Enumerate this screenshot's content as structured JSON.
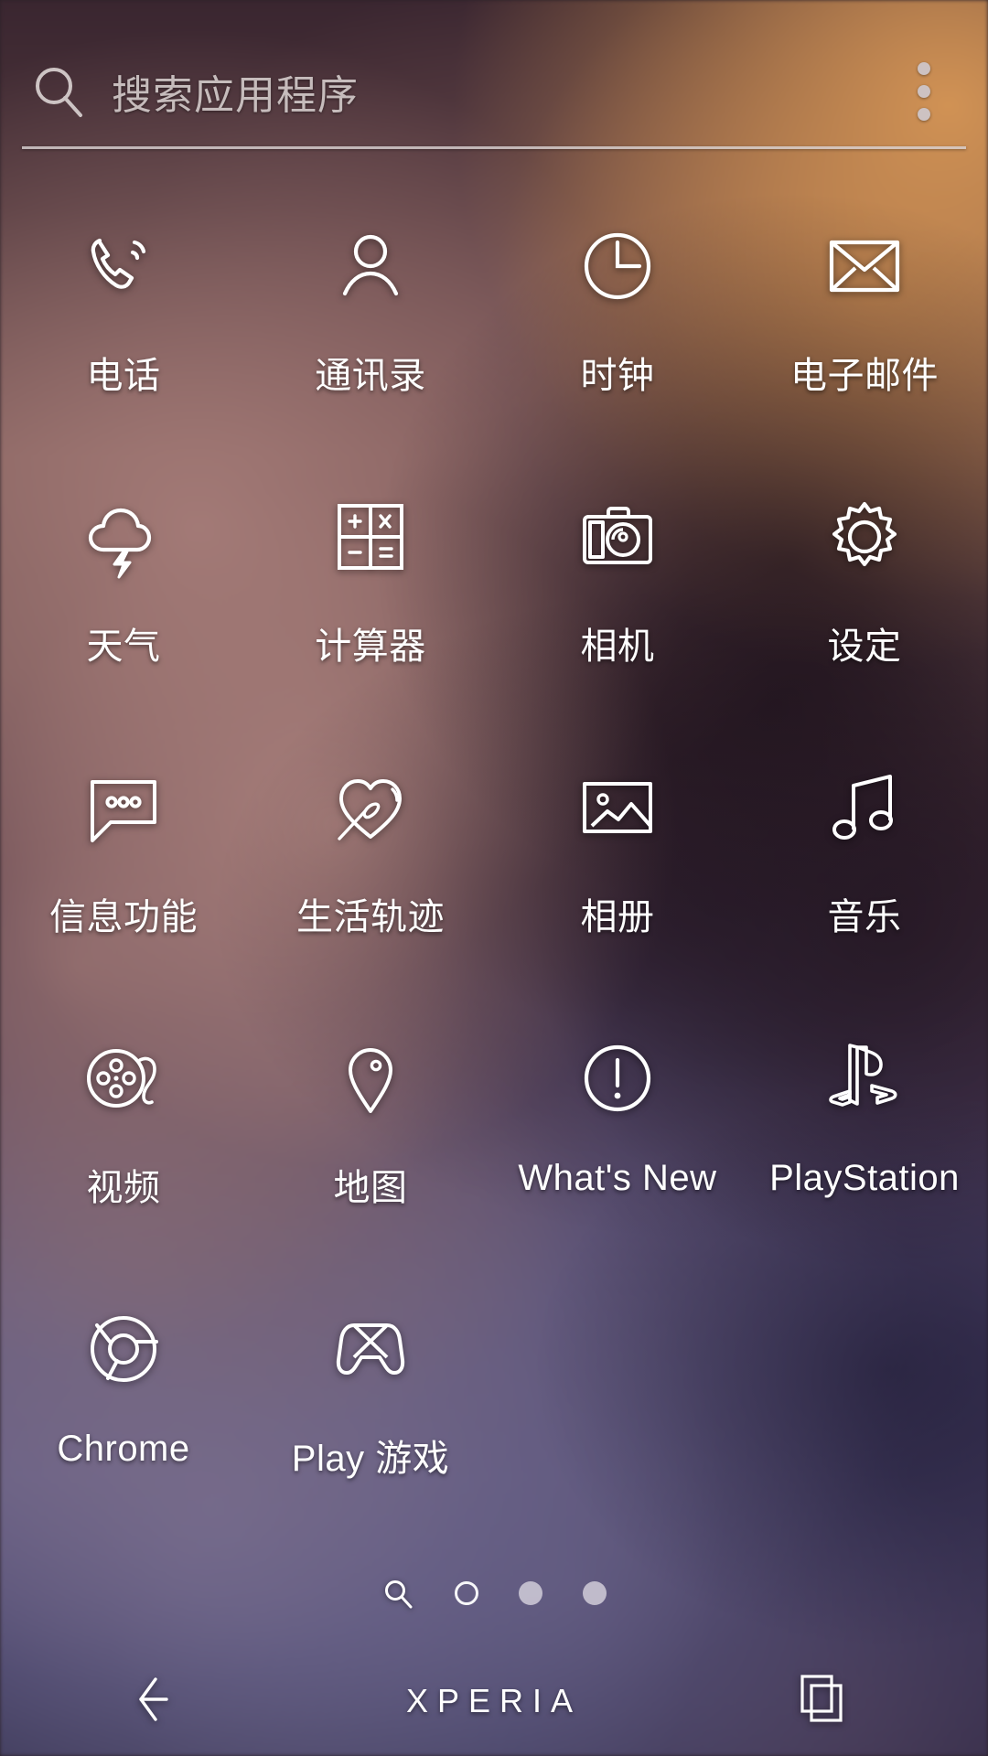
{
  "search": {
    "placeholder": "搜索应用程序",
    "icon": "search-icon",
    "overflow_icon": "more-vertical-icon"
  },
  "apps": [
    {
      "label": "电话",
      "icon": "phone-icon"
    },
    {
      "label": "通讯录",
      "icon": "contacts-person-icon"
    },
    {
      "label": "时钟",
      "icon": "clock-icon"
    },
    {
      "label": "电子邮件",
      "icon": "envelope-icon"
    },
    {
      "label": "天气",
      "icon": "cloud-lightning-icon"
    },
    {
      "label": "计算器",
      "icon": "calculator-icon"
    },
    {
      "label": "相机",
      "icon": "camera-icon"
    },
    {
      "label": "设定",
      "icon": "gear-icon"
    },
    {
      "label": "信息功能",
      "icon": "message-bubble-icon"
    },
    {
      "label": "生活轨迹",
      "icon": "heart-leaf-icon"
    },
    {
      "label": "相册",
      "icon": "photo-album-icon"
    },
    {
      "label": "音乐",
      "icon": "music-note-icon"
    },
    {
      "label": "视频",
      "icon": "film-reel-icon"
    },
    {
      "label": "地图",
      "icon": "map-pin-icon"
    },
    {
      "label": "What's New",
      "icon": "exclamation-circle-icon"
    },
    {
      "label": "PlayStation",
      "icon": "playstation-logo-icon"
    },
    {
      "label": "Chrome",
      "icon": "chrome-logo-icon"
    },
    {
      "label": "Play 游戏",
      "icon": "gamepad-icon"
    }
  ],
  "pager": {
    "search_icon": "search-icon",
    "dots": [
      {
        "state": "current"
      },
      {
        "state": "filled"
      },
      {
        "state": "filled"
      }
    ]
  },
  "navbar": {
    "back_icon": "back-arrow-icon",
    "home_label": "XPERIA",
    "recents_icon": "recents-squares-icon"
  },
  "colors": {
    "icon_stroke": "#ffffff",
    "label_text": "#ffffff",
    "search_hint": "#c6bcbc",
    "divider": "#d8d1d1"
  }
}
